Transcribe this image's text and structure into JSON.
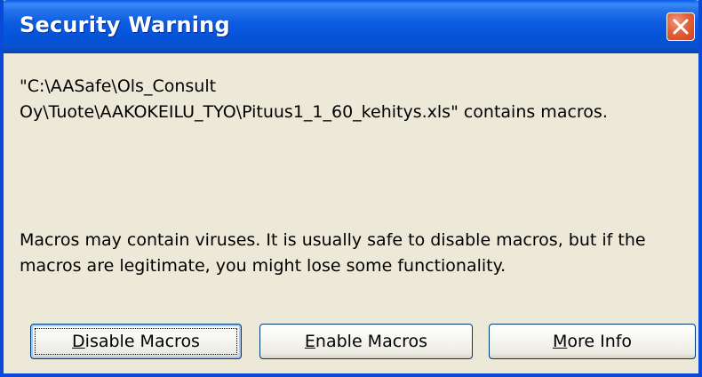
{
  "window": {
    "title": "Security Warning"
  },
  "message": {
    "file_line_1": "\"C:\\AASafe\\Ols_Consult",
    "file_line_2": "Oy\\Tuote\\AAKOKEILU_TYO\\Pituus1_1_60_kehitys.xls\" contains macros.",
    "warning_line_1": "Macros may contain viruses. It is usually safe to disable macros, but if the",
    "warning_line_2": "macros are legitimate, you might lose some functionality."
  },
  "buttons": {
    "disable": {
      "mnemonic": "D",
      "rest": "isable Macros"
    },
    "enable": {
      "mnemonic": "E",
      "rest": "nable Macros"
    },
    "more_info": {
      "before": "",
      "mnemonic": "M",
      "rest": "ore Info"
    }
  },
  "colors": {
    "titlebar": "#0553d8",
    "frame": "#0a4ad8",
    "dialog_bg": "#ece9d8",
    "close_button": "#e2613a"
  }
}
